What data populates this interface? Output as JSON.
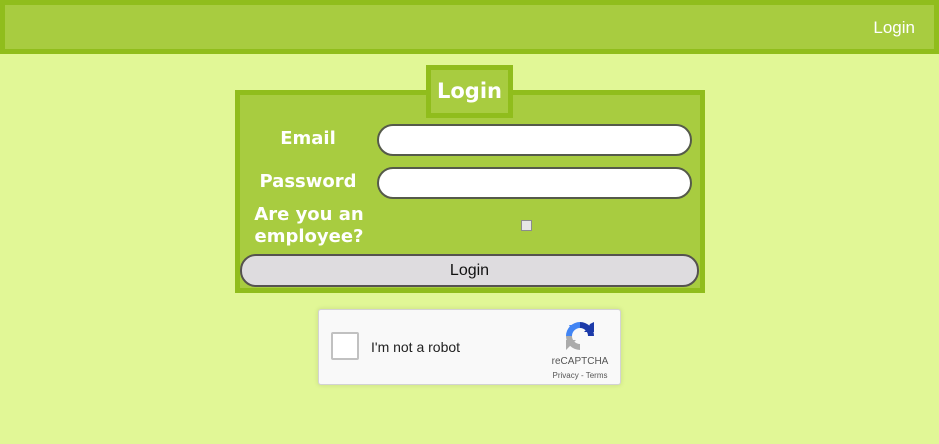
{
  "topbar": {
    "login_link": "Login"
  },
  "login_form": {
    "title": "Login",
    "email_label": "Email",
    "email_value": "",
    "password_label": "Password",
    "password_value": "",
    "employee_label": "Are you an employee?",
    "employee_checked": false,
    "submit_label": "Login"
  },
  "recaptcha": {
    "checkbox_label": "I'm not a robot",
    "brand": "reCAPTCHA",
    "privacy_link": "Privacy",
    "separator": " - ",
    "terms_link": "Terms",
    "logo_icon": "recaptcha-logo-icon"
  },
  "colors": {
    "page_background": "#e1f796",
    "panel_background": "#a8cc40",
    "panel_border": "#90bd1c",
    "button_background": "#dedcdf"
  }
}
